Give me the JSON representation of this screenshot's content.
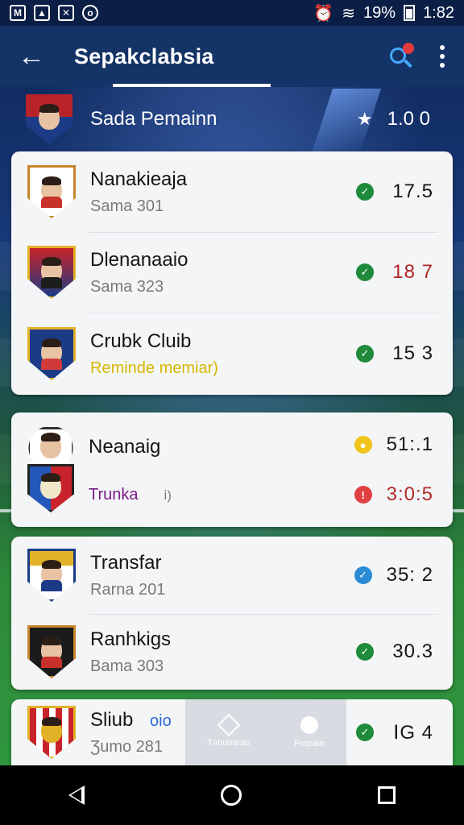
{
  "status_bar": {
    "time": "1:82",
    "battery": "19%",
    "left_icons": [
      "mail-icon",
      "image-icon",
      "cancel-icon",
      "circle-icon"
    ],
    "right_icons": [
      "alarm-icon",
      "wifi-icon",
      "signal-icon",
      "battery-icon"
    ]
  },
  "app_bar": {
    "title": "Sepakclabsia"
  },
  "header": {
    "name": "Sada Pemainn",
    "score": "1.0 0"
  },
  "cards": [
    {
      "rows": [
        {
          "name": "Nanakieaja",
          "sub": "Sama 301",
          "score": "17.5",
          "badge_color": "#1f8a3a",
          "score_color": "dark"
        },
        {
          "name": "Dlenanaaio",
          "sub": "Sama 323",
          "score": "18 7",
          "badge_color": "#1f8a3a",
          "score_color": "red"
        },
        {
          "name": "Crubk Cluib",
          "sub": "Reminde memiar)",
          "score": "15 3",
          "badge_color": "#1f8a3a",
          "score_color": "dark"
        }
      ]
    },
    {
      "rows": [
        {
          "name": "Neanaig",
          "sub": "Trunka",
          "extra": "ⅰ)",
          "score": "51:.1",
          "score2": "3:0:5",
          "badge_color": "#f0c419",
          "badge2_color": "#e04040"
        }
      ]
    },
    {
      "rows": [
        {
          "name": "Transfar",
          "sub": "Rarna 201",
          "score": "35: 2",
          "badge_color": "#2a8ad4"
        },
        {
          "name": "Ranhkigs",
          "sub": "Bama 303",
          "score": "30.3",
          "badge_color": "#1f8a3a"
        }
      ]
    },
    {
      "rows": [
        {
          "name": "Sliub",
          "tag": "oio",
          "sub": "Ʒumo 281",
          "score": "ⅠG 4",
          "badge_color": "#1f8a3a"
        }
      ]
    }
  ],
  "overlay_nav": {
    "items": [
      {
        "label": "Ƭanuoarao",
        "icon": "diamond-icon"
      },
      {
        "label": "Fropaio",
        "icon": "gear-icon"
      }
    ]
  },
  "colors": {
    "app_bar": "#143366",
    "status_bar": "#0b1e46",
    "card": "#f4f5f7",
    "accent_blue": "#44a8ff",
    "notification_dot": "#e23a3a"
  }
}
